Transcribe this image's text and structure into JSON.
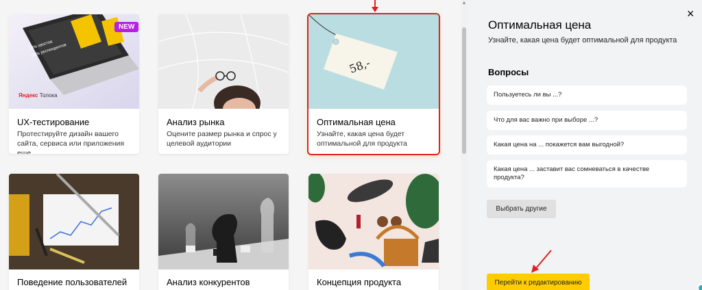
{
  "cards": [
    {
      "title": "UX-тестирование",
      "desc": "Протестируйте дизайн вашего сайта, сервиса или приложения еще...",
      "badge": "NEW",
      "brand_prefix": "Яндекс",
      "brand_suffix": " Толока",
      "laptop_text_1": "18% хвостов",
      "laptop_text_2": "53% респондентов"
    },
    {
      "title": "Анализ рынка",
      "desc": "Оцените размер рынка и спрос у целевой аудитории"
    },
    {
      "title": "Оптимальная цена",
      "desc": "Узнайте, какая цена будет оптимальной для продукта",
      "tag_text": "58,-"
    },
    {
      "title": "Поведение пользователей"
    },
    {
      "title": "Анализ конкурентов"
    },
    {
      "title": "Концепция продукта"
    }
  ],
  "panel": {
    "title": "Оптимальная цена",
    "subtitle": "Узнайте, какая цена будет оптимальной для продукта",
    "close_icon": "×",
    "questions_heading": "Вопросы",
    "questions": [
      "Пользуетесь ли вы ...?",
      "Что для вас важно при выборе ...?",
      "Какая цена на ... покажется вам выгодной?",
      "Какая цена ... заставит вас сомневаться в качестве продукта?"
    ],
    "choose_other_label": "Выбрать другие",
    "go_edit_label": "Перейти к редактированию"
  },
  "scrollbar": {
    "up_arrow": "▲"
  },
  "colors": {
    "accent": "#ffcc00",
    "badge": "#b620e0",
    "highlight": "#e02020",
    "panel_bg": "#f2f3f5"
  }
}
